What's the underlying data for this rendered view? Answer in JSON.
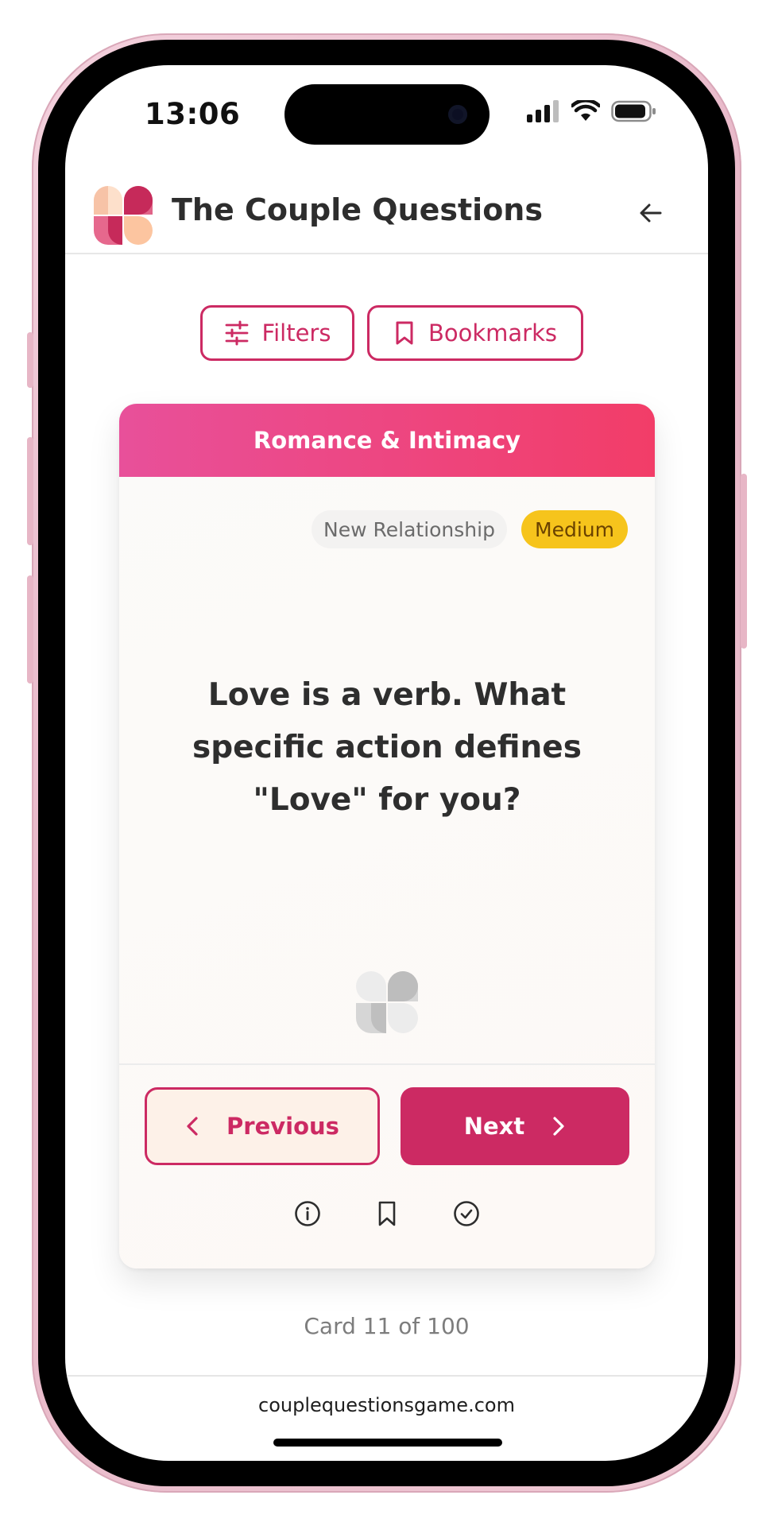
{
  "status_bar": {
    "time": "13:06"
  },
  "header": {
    "title": "The Couple Questions",
    "back_icon": "arrow-left-icon"
  },
  "toolbar": {
    "filters_label": "Filters",
    "bookmarks_label": "Bookmarks"
  },
  "card": {
    "category": "Romance & Intimacy",
    "tags": {
      "relationship": "New Relationship",
      "level": "Medium"
    },
    "question": "Love is a verb. What specific action defines \"Love\" for you?",
    "previous_label": "Previous",
    "next_label": "Next",
    "actions": [
      "info-icon",
      "bookmark-icon",
      "check-circle-icon"
    ]
  },
  "counter": "Card 11 of 100",
  "footer": {
    "url": "couplequestionsgame.com"
  },
  "colors": {
    "accent": "#cc2a63",
    "header_gradient_start": "#e8509a",
    "header_gradient_end": "#f23d68",
    "level_badge": "#f6c41c"
  }
}
